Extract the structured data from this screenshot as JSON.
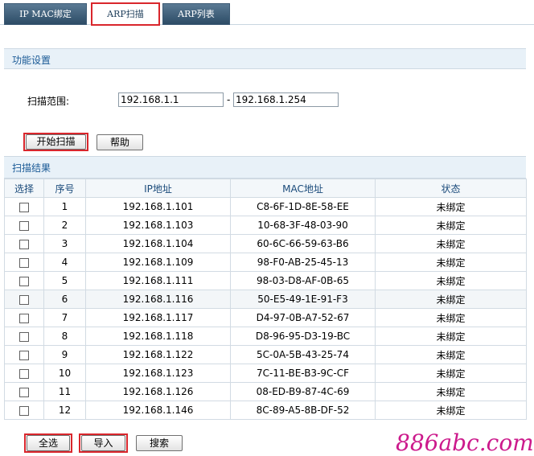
{
  "tabs": [
    {
      "label": "IP MAC绑定"
    },
    {
      "label": "ARP扫描"
    },
    {
      "label": "ARP列表"
    }
  ],
  "settings": {
    "title": "功能设置",
    "range_label": "扫描范围:",
    "range_start": "192.168.1.1",
    "range_sep": "-",
    "range_end": "192.168.1.254",
    "start_button": "开始扫描",
    "help_button": "帮助"
  },
  "results": {
    "title": "扫描结果",
    "columns": [
      "选择",
      "序号",
      "IP地址",
      "MAC地址",
      "状态"
    ],
    "rows": [
      {
        "no": "1",
        "ip": "192.168.1.101",
        "mac": "C8-6F-1D-8E-58-EE",
        "status": "未绑定"
      },
      {
        "no": "2",
        "ip": "192.168.1.103",
        "mac": "10-68-3F-48-03-90",
        "status": "未绑定"
      },
      {
        "no": "3",
        "ip": "192.168.1.104",
        "mac": "60-6C-66-59-63-B6",
        "status": "未绑定"
      },
      {
        "no": "4",
        "ip": "192.168.1.109",
        "mac": "98-F0-AB-25-45-13",
        "status": "未绑定"
      },
      {
        "no": "5",
        "ip": "192.168.1.111",
        "mac": "98-03-D8-AF-0B-65",
        "status": "未绑定"
      },
      {
        "no": "6",
        "ip": "192.168.1.116",
        "mac": "50-E5-49-1E-91-F3",
        "status": "未绑定"
      },
      {
        "no": "7",
        "ip": "192.168.1.117",
        "mac": "D4-97-0B-A7-52-67",
        "status": "未绑定"
      },
      {
        "no": "8",
        "ip": "192.168.1.118",
        "mac": "D8-96-95-D3-19-BC",
        "status": "未绑定"
      },
      {
        "no": "9",
        "ip": "192.168.1.122",
        "mac": "5C-0A-5B-43-25-74",
        "status": "未绑定"
      },
      {
        "no": "10",
        "ip": "192.168.1.123",
        "mac": "7C-11-BE-B3-9C-CF",
        "status": "未绑定"
      },
      {
        "no": "11",
        "ip": "192.168.1.126",
        "mac": "08-ED-B9-87-4C-69",
        "status": "未绑定"
      },
      {
        "no": "12",
        "ip": "192.168.1.146",
        "mac": "8C-89-A5-8B-DF-52",
        "status": "未绑定"
      }
    ]
  },
  "footer": {
    "select_all_button": "全选",
    "import_button": "导入",
    "search_button": "搜索"
  },
  "watermark": "886abc.com"
}
